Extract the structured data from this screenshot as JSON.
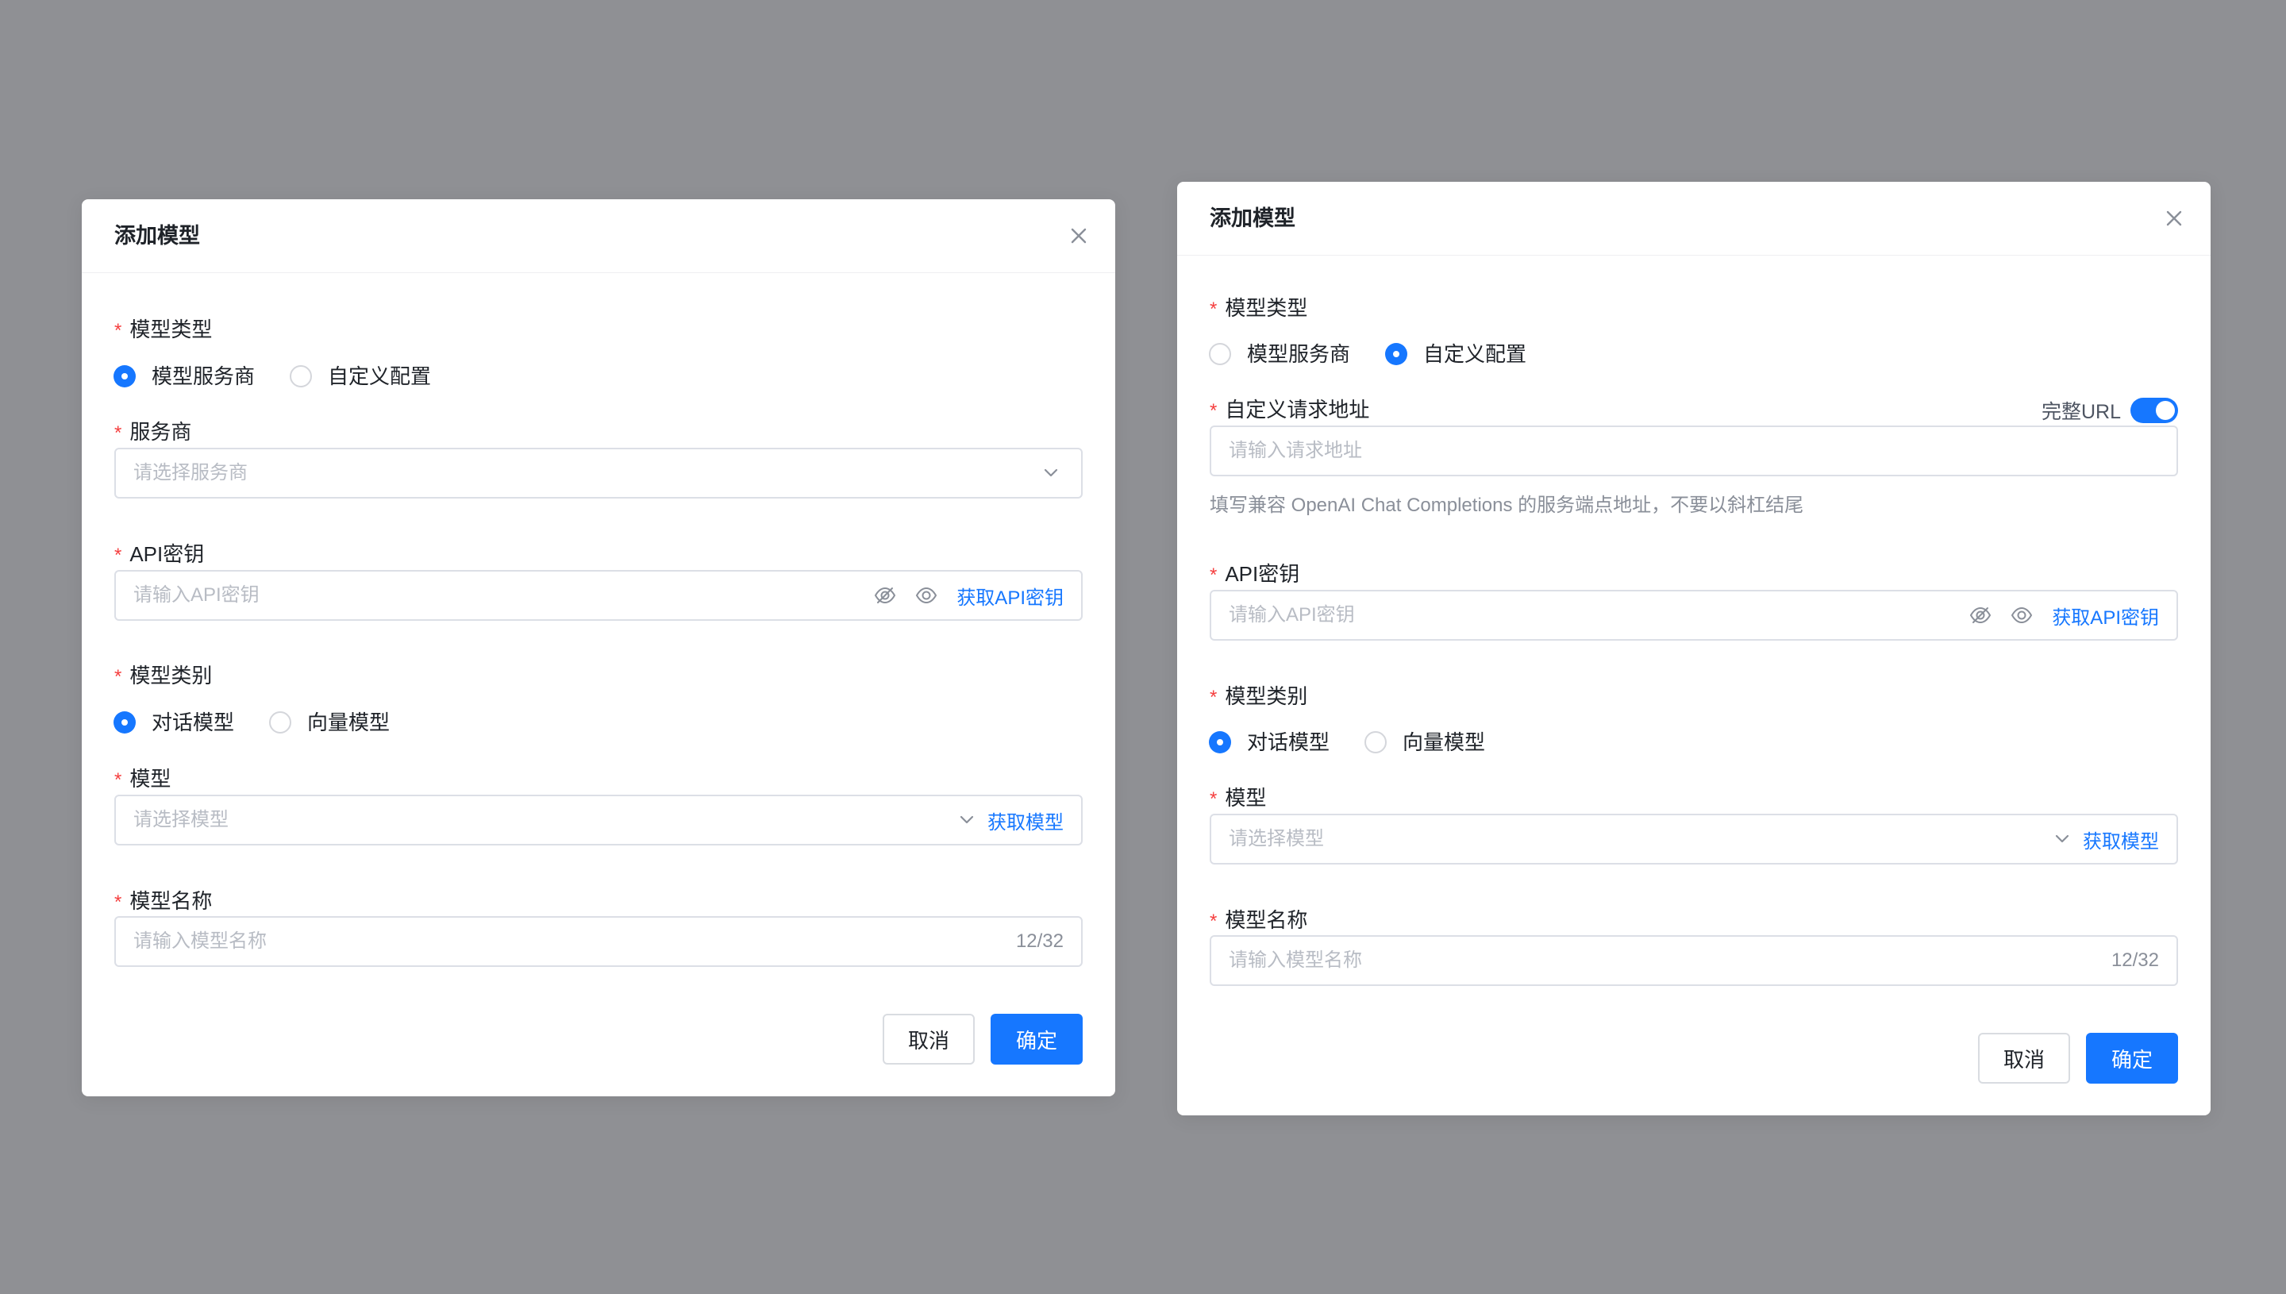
{
  "left_dialog": {
    "title": "添加模型",
    "model_type": {
      "label": "模型类型",
      "options": [
        "模型服务商",
        "自定义配置"
      ],
      "selected": "模型服务商"
    },
    "provider": {
      "label": "服务商",
      "placeholder": "请选择服务商"
    },
    "api_key": {
      "label": "API密钥",
      "placeholder": "请输入API密钥",
      "link": "获取API密钥"
    },
    "model_category": {
      "label": "模型类别",
      "options": [
        "对话模型",
        "向量模型"
      ],
      "selected": "对话模型"
    },
    "model": {
      "label": "模型",
      "placeholder": "请选择模型",
      "link": "获取模型"
    },
    "model_name": {
      "label": "模型名称",
      "placeholder": "请输入模型名称",
      "count": "12/32"
    },
    "cancel": "取消",
    "confirm": "确定"
  },
  "right_dialog": {
    "title": "添加模型",
    "model_type": {
      "label": "模型类型",
      "options": [
        "模型服务商",
        "自定义配置"
      ],
      "selected": "自定义配置"
    },
    "endpoint": {
      "label": "自定义请求地址",
      "full_url_label": "完整URL",
      "full_url_on": true,
      "placeholder": "请输入请求地址",
      "help": "填写兼容 OpenAI Chat Completions 的服务端点地址，不要以斜杠结尾"
    },
    "api_key": {
      "label": "API密钥",
      "placeholder": "请输入API密钥",
      "link": "获取API密钥"
    },
    "model_category": {
      "label": "模型类别",
      "options": [
        "对话模型",
        "向量模型"
      ],
      "selected": "对话模型"
    },
    "model": {
      "label": "模型",
      "placeholder": "请选择模型",
      "link": "获取模型"
    },
    "model_name": {
      "label": "模型名称",
      "placeholder": "请输入模型名称",
      "count": "12/32"
    },
    "cancel": "取消",
    "confirm": "确定"
  },
  "colors": {
    "backdrop": "#8f9094",
    "primary": "#1677ff",
    "required": "#f53f3f",
    "placeholder": "#b8bcc4"
  },
  "icons": [
    "close-icon",
    "eye-off-icon",
    "eye-icon",
    "chevron-down-icon"
  ]
}
